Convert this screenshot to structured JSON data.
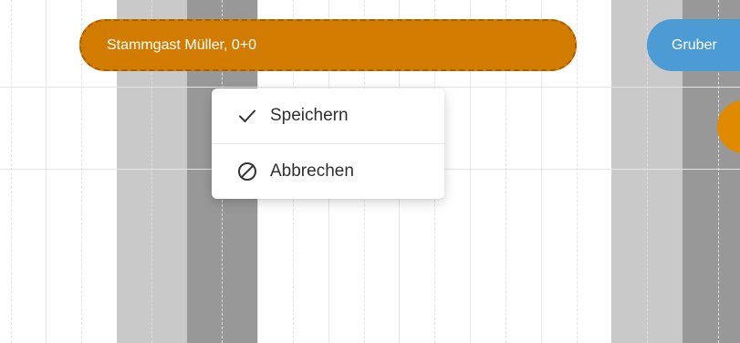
{
  "bookings": {
    "editing": {
      "label": "Stammgast Müller, 0+0",
      "color": "#d17c00",
      "state": "editing"
    },
    "next": {
      "label": "Gruber",
      "color": "#4d9bd5"
    },
    "peek_color": "#e08a00"
  },
  "context_menu": {
    "items": [
      {
        "label": "Speichern",
        "icon": "check-icon"
      },
      {
        "label": "Abbrechen",
        "icon": "cancel-circle-icon"
      }
    ]
  }
}
